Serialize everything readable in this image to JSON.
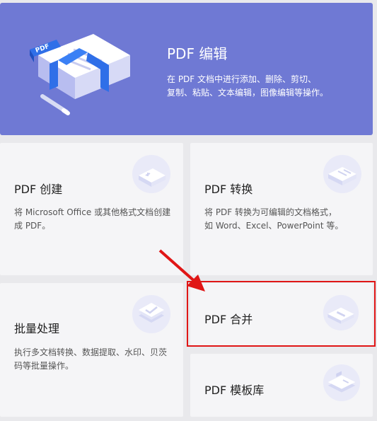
{
  "hero": {
    "badge": "PDF",
    "title": "PDF 编辑",
    "desc_line1": "在 PDF 文档中进行添加、删除、剪切、",
    "desc_line2": "复制、粘贴、文本编辑，图像编辑等操作。"
  },
  "cards": {
    "create": {
      "title": "PDF 创建",
      "desc_line1": "将 Microsoft Office 或其他格式文档创建",
      "desc_line2": "成 PDF。"
    },
    "convert": {
      "title": "PDF 转换",
      "desc_line1": "将 PDF 转换为可编辑的文档格式，",
      "desc_line2": "如 Word、Excel、PowerPoint 等。"
    },
    "batch": {
      "title": "批量处理",
      "desc_line1": "执行多文档转换、数据提取、水印、贝茨",
      "desc_line2": "码等批量操作。"
    },
    "merge": {
      "title": "PDF 合并"
    },
    "templates": {
      "title": "PDF 模板库"
    }
  },
  "colors": {
    "hero_bg": "#6f79d4",
    "card_bg": "#f5f5f7",
    "highlight": "#e01616"
  }
}
